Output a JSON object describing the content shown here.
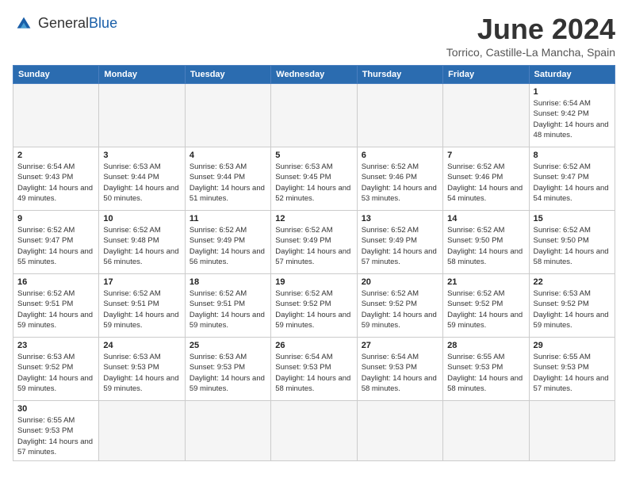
{
  "header": {
    "logo_general": "General",
    "logo_blue": "Blue",
    "title": "June 2024",
    "subtitle": "Torrico, Castille-La Mancha, Spain"
  },
  "calendar": {
    "days_of_week": [
      "Sunday",
      "Monday",
      "Tuesday",
      "Wednesday",
      "Thursday",
      "Friday",
      "Saturday"
    ],
    "weeks": [
      [
        {
          "day": "",
          "info": ""
        },
        {
          "day": "",
          "info": ""
        },
        {
          "day": "",
          "info": ""
        },
        {
          "day": "",
          "info": ""
        },
        {
          "day": "",
          "info": ""
        },
        {
          "day": "",
          "info": ""
        },
        {
          "day": "1",
          "info": "Sunrise: 6:54 AM\nSunset: 9:42 PM\nDaylight: 14 hours and 48 minutes."
        }
      ],
      [
        {
          "day": "2",
          "info": "Sunrise: 6:54 AM\nSunset: 9:43 PM\nDaylight: 14 hours and 49 minutes."
        },
        {
          "day": "3",
          "info": "Sunrise: 6:53 AM\nSunset: 9:44 PM\nDaylight: 14 hours and 50 minutes."
        },
        {
          "day": "4",
          "info": "Sunrise: 6:53 AM\nSunset: 9:44 PM\nDaylight: 14 hours and 51 minutes."
        },
        {
          "day": "5",
          "info": "Sunrise: 6:53 AM\nSunset: 9:45 PM\nDaylight: 14 hours and 52 minutes."
        },
        {
          "day": "6",
          "info": "Sunrise: 6:52 AM\nSunset: 9:46 PM\nDaylight: 14 hours and 53 minutes."
        },
        {
          "day": "7",
          "info": "Sunrise: 6:52 AM\nSunset: 9:46 PM\nDaylight: 14 hours and 54 minutes."
        },
        {
          "day": "8",
          "info": "Sunrise: 6:52 AM\nSunset: 9:47 PM\nDaylight: 14 hours and 54 minutes."
        }
      ],
      [
        {
          "day": "9",
          "info": "Sunrise: 6:52 AM\nSunset: 9:47 PM\nDaylight: 14 hours and 55 minutes."
        },
        {
          "day": "10",
          "info": "Sunrise: 6:52 AM\nSunset: 9:48 PM\nDaylight: 14 hours and 56 minutes."
        },
        {
          "day": "11",
          "info": "Sunrise: 6:52 AM\nSunset: 9:49 PM\nDaylight: 14 hours and 56 minutes."
        },
        {
          "day": "12",
          "info": "Sunrise: 6:52 AM\nSunset: 9:49 PM\nDaylight: 14 hours and 57 minutes."
        },
        {
          "day": "13",
          "info": "Sunrise: 6:52 AM\nSunset: 9:49 PM\nDaylight: 14 hours and 57 minutes."
        },
        {
          "day": "14",
          "info": "Sunrise: 6:52 AM\nSunset: 9:50 PM\nDaylight: 14 hours and 58 minutes."
        },
        {
          "day": "15",
          "info": "Sunrise: 6:52 AM\nSunset: 9:50 PM\nDaylight: 14 hours and 58 minutes."
        }
      ],
      [
        {
          "day": "16",
          "info": "Sunrise: 6:52 AM\nSunset: 9:51 PM\nDaylight: 14 hours and 59 minutes."
        },
        {
          "day": "17",
          "info": "Sunrise: 6:52 AM\nSunset: 9:51 PM\nDaylight: 14 hours and 59 minutes."
        },
        {
          "day": "18",
          "info": "Sunrise: 6:52 AM\nSunset: 9:51 PM\nDaylight: 14 hours and 59 minutes."
        },
        {
          "day": "19",
          "info": "Sunrise: 6:52 AM\nSunset: 9:52 PM\nDaylight: 14 hours and 59 minutes."
        },
        {
          "day": "20",
          "info": "Sunrise: 6:52 AM\nSunset: 9:52 PM\nDaylight: 14 hours and 59 minutes."
        },
        {
          "day": "21",
          "info": "Sunrise: 6:52 AM\nSunset: 9:52 PM\nDaylight: 14 hours and 59 minutes."
        },
        {
          "day": "22",
          "info": "Sunrise: 6:53 AM\nSunset: 9:52 PM\nDaylight: 14 hours and 59 minutes."
        }
      ],
      [
        {
          "day": "23",
          "info": "Sunrise: 6:53 AM\nSunset: 9:52 PM\nDaylight: 14 hours and 59 minutes."
        },
        {
          "day": "24",
          "info": "Sunrise: 6:53 AM\nSunset: 9:53 PM\nDaylight: 14 hours and 59 minutes."
        },
        {
          "day": "25",
          "info": "Sunrise: 6:53 AM\nSunset: 9:53 PM\nDaylight: 14 hours and 59 minutes."
        },
        {
          "day": "26",
          "info": "Sunrise: 6:54 AM\nSunset: 9:53 PM\nDaylight: 14 hours and 58 minutes."
        },
        {
          "day": "27",
          "info": "Sunrise: 6:54 AM\nSunset: 9:53 PM\nDaylight: 14 hours and 58 minutes."
        },
        {
          "day": "28",
          "info": "Sunrise: 6:55 AM\nSunset: 9:53 PM\nDaylight: 14 hours and 58 minutes."
        },
        {
          "day": "29",
          "info": "Sunrise: 6:55 AM\nSunset: 9:53 PM\nDaylight: 14 hours and 57 minutes."
        }
      ],
      [
        {
          "day": "30",
          "info": "Sunrise: 6:55 AM\nSunset: 9:53 PM\nDaylight: 14 hours and 57 minutes."
        },
        {
          "day": "",
          "info": ""
        },
        {
          "day": "",
          "info": ""
        },
        {
          "day": "",
          "info": ""
        },
        {
          "day": "",
          "info": ""
        },
        {
          "day": "",
          "info": ""
        },
        {
          "day": "",
          "info": ""
        }
      ]
    ]
  }
}
